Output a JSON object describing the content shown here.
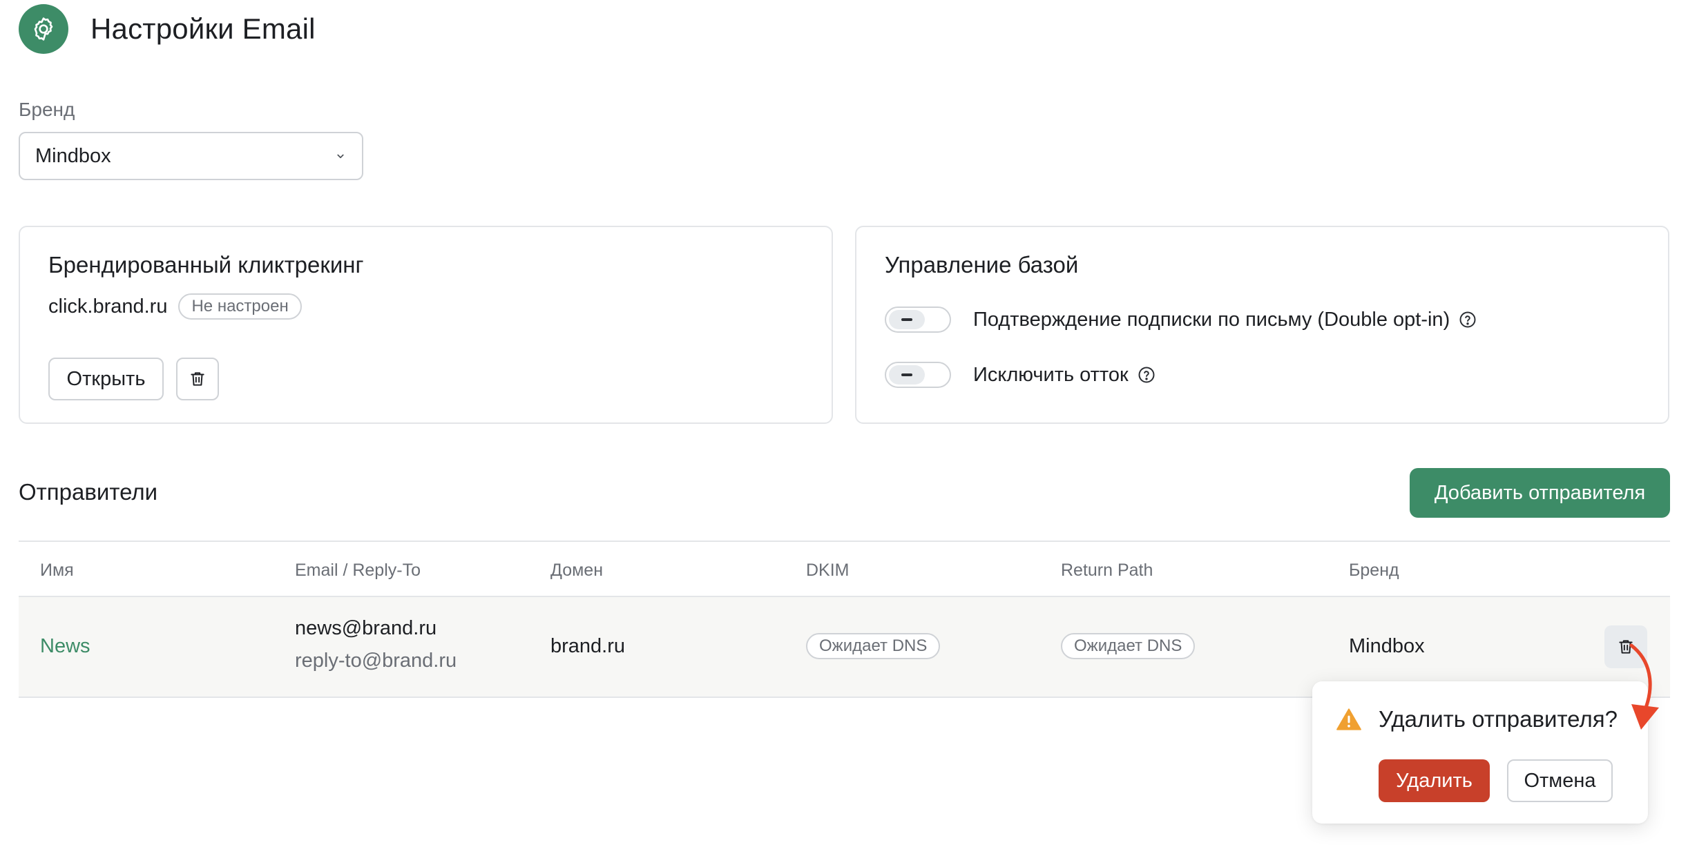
{
  "header": {
    "title": "Настройки Email",
    "icon": "gear-icon"
  },
  "brand_field": {
    "label": "Бренд",
    "value": "Mindbox"
  },
  "click_tracking": {
    "title": "Брендированный кликтрекинг",
    "domain": "click.brand.ru",
    "status": "Не настроен",
    "open_label": "Открыть"
  },
  "base_management": {
    "title": "Управление базой",
    "double_opt_in_label": "Подтверждение подписки по письму (Double opt-in)",
    "exclude_churn_label": "Исключить отток"
  },
  "senders": {
    "title": "Отправители",
    "add_label": "Добавить отправителя",
    "columns": {
      "name": "Имя",
      "email": "Email / Reply-To",
      "domain": "Домен",
      "dkim": "DKIM",
      "return_path": "Return Path",
      "brand": "Бренд"
    },
    "rows": [
      {
        "name": "News",
        "email": "news@brand.ru",
        "reply_to": "reply-to@brand.ru",
        "domain": "brand.ru",
        "dkim": "Ожидает DNS",
        "return_path": "Ожидает DNS",
        "brand": "Mindbox"
      }
    ]
  },
  "delete_popover": {
    "question": "Удалить отправителя?",
    "confirm_label": "Удалить",
    "cancel_label": "Отмена"
  },
  "colors": {
    "accent": "#3d8c67",
    "danger": "#c8402a",
    "warning": "#f0a030",
    "annotation_arrow": "#e8472b"
  }
}
